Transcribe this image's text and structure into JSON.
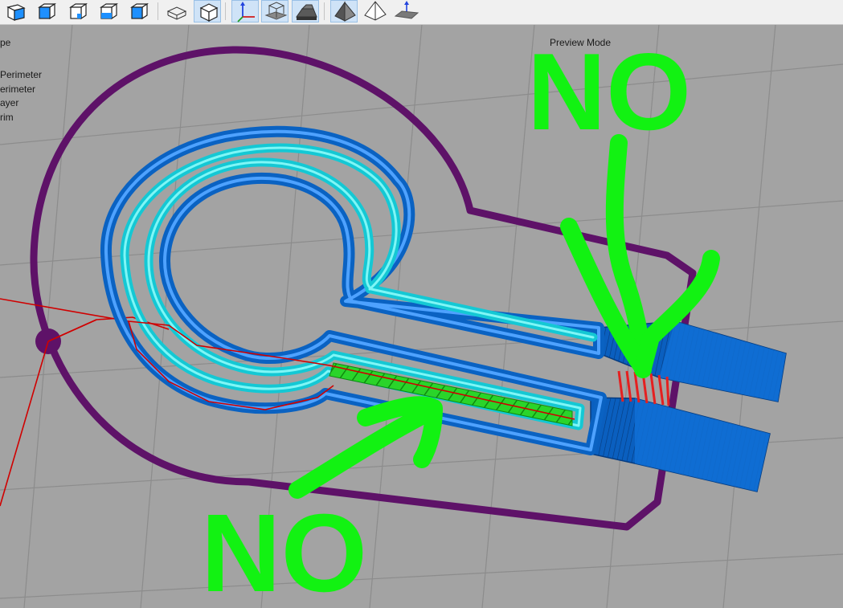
{
  "toolbar": {
    "buttons": [
      {
        "icon": "view-iso-cube-icon",
        "active": false
      },
      {
        "icon": "view-front-cube-icon",
        "active": false
      },
      {
        "icon": "view-top-cube-icon",
        "active": false
      },
      {
        "icon": "view-left-cube-icon",
        "active": false
      },
      {
        "icon": "view-right-cube-icon",
        "active": false
      },
      {
        "icon": "wireframe-box-icon",
        "active": false
      },
      {
        "icon": "solid-cube-icon",
        "active": true
      },
      {
        "icon": "axes-icon",
        "active": true
      },
      {
        "icon": "bounding-box-icon",
        "active": true
      },
      {
        "icon": "solid-shape-icon",
        "active": true
      },
      {
        "icon": "pyramid-solid-icon",
        "active": true
      },
      {
        "icon": "pyramid-wire-icon",
        "active": false
      },
      {
        "icon": "build-plate-icon",
        "active": false
      }
    ]
  },
  "legend": {
    "items": [
      "pe",
      "Perimeter",
      "erimeter",
      "ayer",
      "rim"
    ]
  },
  "preview_mode_label": "Preview Mode",
  "annotations": {
    "top": "NO",
    "bottom": "NO"
  },
  "colors": {
    "background": "#a3a3a3",
    "grid": "#8e8e8e",
    "skirt": "#5e1268",
    "outer_perimeter": "#0a62c2",
    "inner_perimeter": "#14dcdc",
    "infill": "#2ad42a",
    "travel": "#d00000",
    "annotation": "#12f212"
  }
}
